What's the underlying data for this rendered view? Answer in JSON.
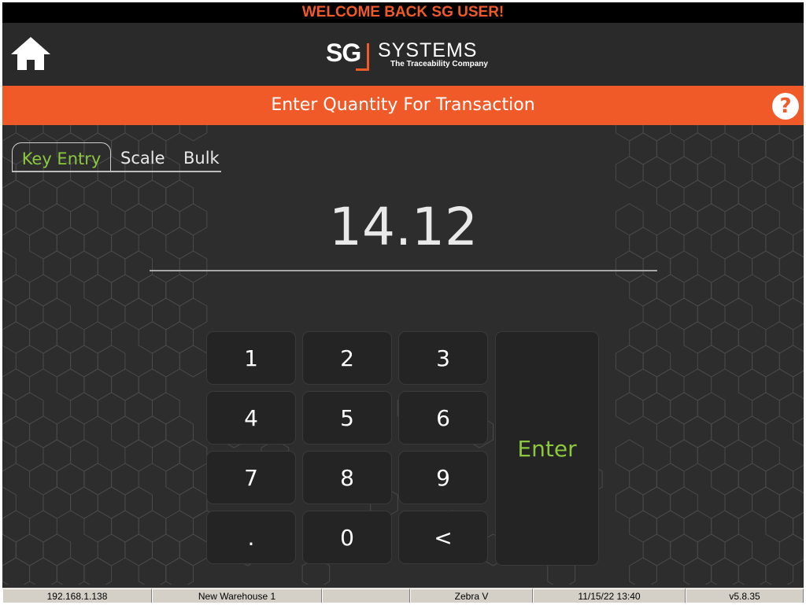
{
  "welcome": "WELCOME BACK SG USER!",
  "header": {
    "logo_mark": "SG",
    "logo_word": "SYSTEMS",
    "logo_tagline": "The Traceability Company"
  },
  "titlebar": {
    "title": "Enter Quantity For Transaction",
    "help_label": "?"
  },
  "tabs": [
    {
      "label": "Key Entry",
      "active": true
    },
    {
      "label": "Scale",
      "active": false
    },
    {
      "label": "Bulk",
      "active": false
    }
  ],
  "quantity": "14.12",
  "keypad": {
    "keys": [
      "1",
      "2",
      "3",
      "4",
      "5",
      "6",
      "7",
      "8",
      "9",
      ".",
      "0",
      "<"
    ],
    "enter_label": "Enter"
  },
  "statusbar": {
    "ip": "192.168.1.138",
    "warehouse": "New Warehouse 1",
    "blank": "",
    "printer": "Zebra V",
    "datetime": "11/15/22 13:40",
    "version": "v5.8.35"
  },
  "colors": {
    "accent": "#f05a28",
    "active_tab": "#8dc63f",
    "background": "#2d2d2d"
  },
  "icons": {
    "home": "home-icon",
    "help": "help-icon"
  }
}
